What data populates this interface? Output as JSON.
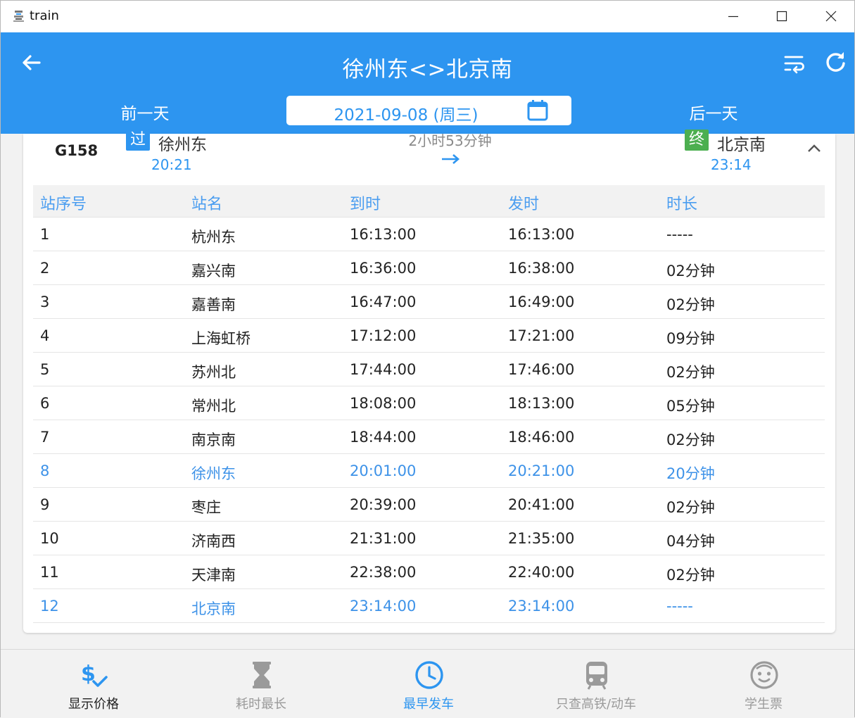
{
  "window": {
    "title": "train"
  },
  "header": {
    "title": "徐州东<>北京南",
    "prev_day": "前一天",
    "next_day": "后一天",
    "date": "2021-09-08 (周三)",
    "accent_color": "#2d95f0"
  },
  "train": {
    "number": "G158",
    "from_badge": "过",
    "from_station": "徐州东",
    "from_time": "20:21",
    "duration": "2小时53分钟",
    "to_badge": "终",
    "to_station": "北京南",
    "to_time": "23:14"
  },
  "table": {
    "headers": [
      "站序号",
      "站名",
      "到时",
      "发时",
      "时长"
    ],
    "rows": [
      {
        "no": "1",
        "name": "杭州东",
        "arrive": "16:13:00",
        "depart": "16:13:00",
        "stay": "-----",
        "highlight": false
      },
      {
        "no": "2",
        "name": "嘉兴南",
        "arrive": "16:36:00",
        "depart": "16:38:00",
        "stay": "02分钟",
        "highlight": false
      },
      {
        "no": "3",
        "name": "嘉善南",
        "arrive": "16:47:00",
        "depart": "16:49:00",
        "stay": "02分钟",
        "highlight": false
      },
      {
        "no": "4",
        "name": "上海虹桥",
        "arrive": "17:12:00",
        "depart": "17:21:00",
        "stay": "09分钟",
        "highlight": false
      },
      {
        "no": "5",
        "name": "苏州北",
        "arrive": "17:44:00",
        "depart": "17:46:00",
        "stay": "02分钟",
        "highlight": false
      },
      {
        "no": "6",
        "name": "常州北",
        "arrive": "18:08:00",
        "depart": "18:13:00",
        "stay": "05分钟",
        "highlight": false
      },
      {
        "no": "7",
        "name": "南京南",
        "arrive": "18:44:00",
        "depart": "18:46:00",
        "stay": "02分钟",
        "highlight": false
      },
      {
        "no": "8",
        "name": "徐州东",
        "arrive": "20:01:00",
        "depart": "20:21:00",
        "stay": "20分钟",
        "highlight": true
      },
      {
        "no": "9",
        "name": "枣庄",
        "arrive": "20:39:00",
        "depart": "20:41:00",
        "stay": "02分钟",
        "highlight": false
      },
      {
        "no": "10",
        "name": "济南西",
        "arrive": "21:31:00",
        "depart": "21:35:00",
        "stay": "04分钟",
        "highlight": false
      },
      {
        "no": "11",
        "name": "天津南",
        "arrive": "22:38:00",
        "depart": "22:40:00",
        "stay": "02分钟",
        "highlight": false
      },
      {
        "no": "12",
        "name": "北京南",
        "arrive": "23:14:00",
        "depart": "23:14:00",
        "stay": "-----",
        "highlight": true
      }
    ]
  },
  "bottom_nav": [
    {
      "label": "显示价格",
      "icon": "price-check-icon",
      "state": "dark"
    },
    {
      "label": "耗时最长",
      "icon": "hourglass-icon",
      "state": "inactive"
    },
    {
      "label": "最早发车",
      "icon": "clock-icon",
      "state": "active"
    },
    {
      "label": "只查高铁/动车",
      "icon": "train-icon",
      "state": "inactive"
    },
    {
      "label": "学生票",
      "icon": "student-face-icon",
      "state": "inactive"
    }
  ]
}
